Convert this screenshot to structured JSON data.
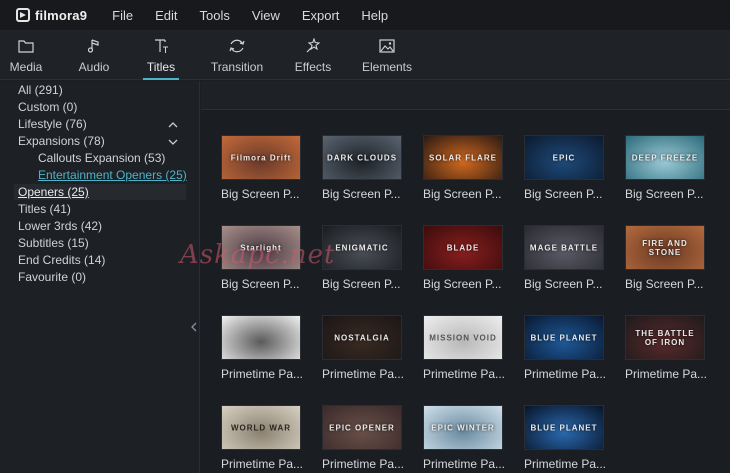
{
  "app": {
    "name": "filmora9"
  },
  "menu": [
    "File",
    "Edit",
    "Tools",
    "View",
    "Export",
    "Help"
  ],
  "toolbar": {
    "tabs": [
      {
        "label": "Media",
        "icon": "folder-icon"
      },
      {
        "label": "Audio",
        "icon": "music-note-icon"
      },
      {
        "label": "Titles",
        "icon": "title-text-icon",
        "active": true
      },
      {
        "label": "Transition",
        "icon": "transition-icon"
      },
      {
        "label": "Effects",
        "icon": "effects-sparkle-icon"
      },
      {
        "label": "Elements",
        "icon": "image-icon"
      }
    ],
    "accent_color": "#4fb3c8"
  },
  "sidebar": {
    "categories": [
      {
        "label": "All (291)"
      },
      {
        "label": "Custom (0)"
      },
      {
        "label": "Lifestyle (76)",
        "expandable": true
      },
      {
        "label": "Expansions (78)",
        "expandable": true
      },
      {
        "label": "Callouts Expansion (53)",
        "sub": true
      },
      {
        "label": "Entertainment Openers (25)",
        "sub": true,
        "link": true
      },
      {
        "label": "Openers (25)",
        "selected": true
      },
      {
        "label": "Titles (41)"
      },
      {
        "label": "Lower 3rds (42)"
      },
      {
        "label": "Subtitles (15)"
      },
      {
        "label": "End Credits (14)"
      },
      {
        "label": "Favourite (0)"
      }
    ]
  },
  "grid": {
    "rows": [
      [
        {
          "label": "Big Screen P...",
          "thumb_text": "Filmora Drift",
          "colors": [
            "#c26a3a",
            "#6b3a2a"
          ]
        },
        {
          "label": "Big Screen P...",
          "thumb_text": "DARK CLOUDS",
          "colors": [
            "#5a6470",
            "#1c2228"
          ]
        },
        {
          "label": "Big Screen P...",
          "thumb_text": "SOLAR FLARE",
          "colors": [
            "#2a1a14",
            "#d2691e"
          ]
        },
        {
          "label": "Big Screen P...",
          "thumb_text": "EPIC",
          "colors": [
            "#0c1a2e",
            "#1e4a7a"
          ]
        },
        {
          "label": "Big Screen P...",
          "thumb_text": "DEEP FREEZE",
          "colors": [
            "#2c6a7a",
            "#9ccad6"
          ]
        }
      ],
      [
        {
          "label": "Big Screen P...",
          "thumb_text": "Starlight",
          "colors": [
            "#a8908a",
            "#4a3a44"
          ]
        },
        {
          "label": "Big Screen P...",
          "thumb_text": "ENIGMATIC",
          "colors": [
            "#1a1c20",
            "#4a4e56"
          ]
        },
        {
          "label": "Big Screen P...",
          "thumb_text": "BLADE",
          "colors": [
            "#3a0c0c",
            "#8a1e1e"
          ]
        },
        {
          "label": "Big Screen P...",
          "thumb_text": "MAGE BATTLE",
          "colors": [
            "#2a2a30",
            "#5a5a66"
          ]
        },
        {
          "label": "Big Screen P...",
          "thumb_text": "FIRE AND STONE",
          "colors": [
            "#b46a3e",
            "#6a3a24"
          ]
        }
      ],
      [
        {
          "label": "Primetime Pa...",
          "thumb_text": "",
          "colors": [
            "#f2f2f2",
            "#5a5a5a"
          ]
        },
        {
          "label": "Primetime Pa...",
          "thumb_text": "NOSTALGIA",
          "colors": [
            "#1a1616",
            "#3a2a22"
          ]
        },
        {
          "label": "Primetime Pa...",
          "thumb_text": "MISSION VOID",
          "colors": [
            "#eeeeee",
            "#b8b8b8"
          ]
        },
        {
          "label": "Primetime Pa...",
          "thumb_text": "BLUE PLANET",
          "colors": [
            "#0a1830",
            "#1e5a9a"
          ]
        },
        {
          "label": "Primetime Pa...",
          "thumb_text": "THE BATTLE OF IRON",
          "colors": [
            "#1e1a1c",
            "#5a2a2a"
          ]
        }
      ],
      [
        {
          "label": "Primetime Pa...",
          "thumb_text": "WORLD WAR",
          "colors": [
            "#d8d2c4",
            "#8a8070"
          ]
        },
        {
          "label": "Primetime Pa...",
          "thumb_text": "EPIC OPENER",
          "colors": [
            "#3a2a2a",
            "#6a5048"
          ]
        },
        {
          "label": "Primetime Pa...",
          "thumb_text": "EPIC WINTER",
          "colors": [
            "#cfe0ea",
            "#6a8aa0"
          ]
        },
        {
          "label": "Primetime Pa...",
          "thumb_text": "BLUE PLANET",
          "colors": [
            "#081428",
            "#2a6ab0"
          ]
        }
      ]
    ]
  },
  "watermark": "Askapc.net"
}
